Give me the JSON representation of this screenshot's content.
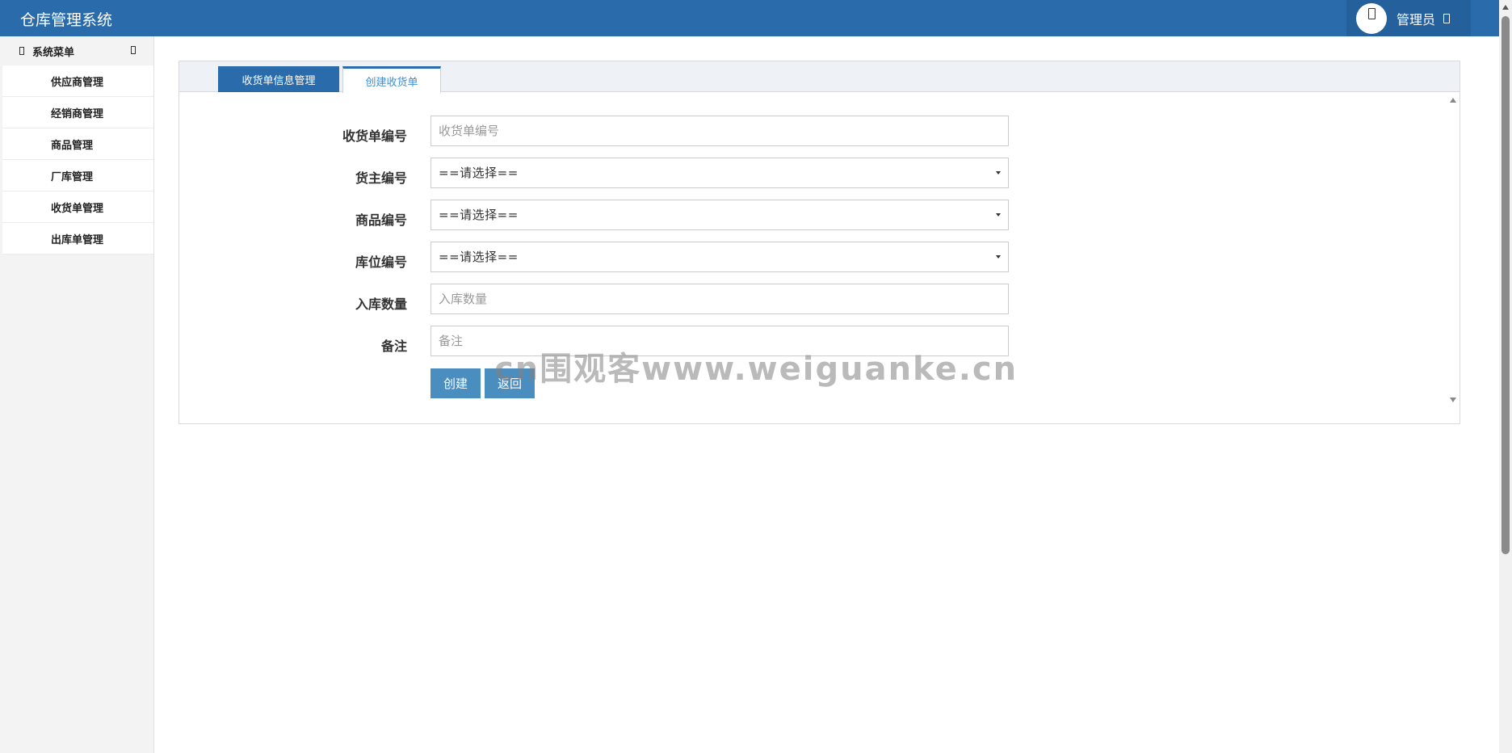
{
  "app": {
    "title": "仓库管理系统"
  },
  "user": {
    "name": "管理员",
    "avatar_icon": "user-icon",
    "menu_icon": "caret-icon"
  },
  "sidebar": {
    "header": "系统菜单",
    "items": [
      {
        "label": "供应商管理"
      },
      {
        "label": "经销商管理"
      },
      {
        "label": "商品管理"
      },
      {
        "label": "厂库管理"
      },
      {
        "label": "收货单管理"
      },
      {
        "label": "出库单管理"
      }
    ]
  },
  "tabs": [
    {
      "label": "收货单信息管理",
      "active": false
    },
    {
      "label": "创建收货单",
      "active": true
    }
  ],
  "form": {
    "receipt_no": {
      "label": "收货单编号",
      "placeholder": "收货单编号"
    },
    "owner_no": {
      "label": "货主编号",
      "value": "==请选择=="
    },
    "goods_no": {
      "label": "商品编号",
      "value": "==请选择=="
    },
    "location_no": {
      "label": "库位编号",
      "value": "==请选择=="
    },
    "quantity": {
      "label": "入库数量",
      "placeholder": "入库数量"
    },
    "remark": {
      "label": "备注",
      "placeholder": "备注"
    },
    "create_label": "创建",
    "back_label": "返回"
  },
  "watermark": "cn围观客www.weiguanke.cn",
  "colors": {
    "header": "#2a6cab",
    "user_area": "#24619c",
    "button": "#4a8ec0",
    "tab_active_text": "#3b8fd4"
  }
}
